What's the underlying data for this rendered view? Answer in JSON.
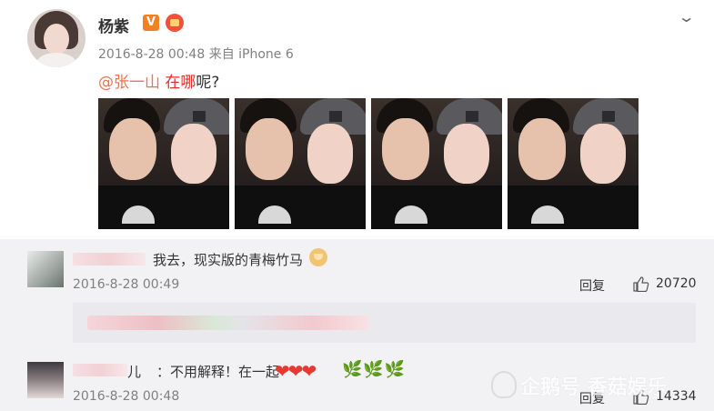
{
  "post": {
    "username": "杨紫",
    "verified_badge": "V",
    "timestamp": "2016-8-28 00:48",
    "source_prefix": "来自",
    "source_device": "iPhone 6",
    "mention": "@张一山",
    "location_phrase": "在哪",
    "text_suffix": "呢?",
    "menu_icon": "chevron-down-icon",
    "photos": [
      {
        "label": "photo-1"
      },
      {
        "label": "photo-2"
      },
      {
        "label": "photo-3"
      },
      {
        "label": "photo-4"
      }
    ]
  },
  "comments": [
    {
      "text": "我去，现实版的青梅竹马",
      "emoji": "dog-emoji",
      "time": "2016-8-28 00:49",
      "reply_label": "回复",
      "likes": "20720"
    },
    {
      "name_tail": "儿",
      "text": "：不用解释！在一起",
      "hearts": "❤❤❤",
      "leaves": "🌿🌿🌿",
      "time": "2016-8-28 00:48",
      "reply_label": "回复",
      "likes": "14334"
    }
  ],
  "watermark": "企鹅号 香菇娱乐",
  "colors": {
    "mention": "#eb7350",
    "location": "#e0312a",
    "meta_grey": "#808080",
    "comment_bg": "#f2f2f5"
  }
}
